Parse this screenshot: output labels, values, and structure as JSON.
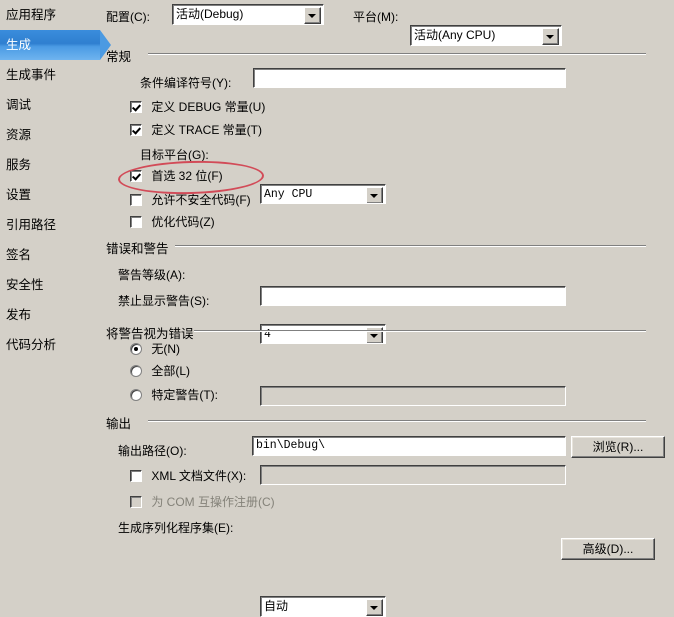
{
  "sidebar": {
    "items": [
      {
        "label": "应用程序",
        "selected": false
      },
      {
        "label": "生成",
        "selected": true
      },
      {
        "label": "生成事件",
        "selected": false
      },
      {
        "label": "调试",
        "selected": false
      },
      {
        "label": "资源",
        "selected": false
      },
      {
        "label": "服务",
        "selected": false
      },
      {
        "label": "设置",
        "selected": false
      },
      {
        "label": "引用路径",
        "selected": false
      },
      {
        "label": "签名",
        "selected": false
      },
      {
        "label": "安全性",
        "selected": false
      },
      {
        "label": "发布",
        "selected": false
      },
      {
        "label": "代码分析",
        "selected": false
      }
    ]
  },
  "top": {
    "configuration_label": "配置(C):",
    "configuration_value": "活动(Debug)",
    "platform_label": "平台(M):",
    "platform_value": "活动(Any CPU)"
  },
  "general": {
    "title": "常规",
    "conditional_symbols_label": "条件编译符号(Y):",
    "conditional_symbols_value": "",
    "define_debug_label": "定义 DEBUG 常量(U)",
    "define_debug_checked": true,
    "define_trace_label": "定义 TRACE 常量(T)",
    "define_trace_checked": true,
    "target_platform_label": "目标平台(G):",
    "target_platform_value": "Any CPU",
    "prefer32_label": "首选 32 位(F)",
    "prefer32_checked": true,
    "unsafe_label": "允许不安全代码(F)",
    "unsafe_checked": false,
    "optimize_label": "优化代码(Z)",
    "optimize_checked": false
  },
  "errors": {
    "title": "错误和警告",
    "warning_level_label": "警告等级(A):",
    "warning_level_value": "4",
    "suppress_warnings_label": "禁止显示警告(S):",
    "suppress_warnings_value": ""
  },
  "treat_warnings": {
    "title": "将警告视为错误",
    "none_label": "无(N)",
    "none_selected": true,
    "all_label": "全部(L)",
    "all_selected": false,
    "specific_label": "特定警告(T):",
    "specific_selected": false,
    "specific_value": ""
  },
  "output": {
    "title": "输出",
    "path_label": "输出路径(O):",
    "path_value": "bin\\Debug\\",
    "browse_label": "浏览(R)...",
    "xml_doc_label": "XML 文档文件(X):",
    "xml_doc_checked": false,
    "xml_doc_value": "",
    "com_interop_label": "为 COM 互操作注册(C)",
    "com_interop_checked": false,
    "serialization_label": "生成序列化程序集(E):",
    "serialization_value": "自动",
    "advanced_label": "高级(D)..."
  },
  "annotation": {
    "shape": "ellipse",
    "color": "#d24b58",
    "target": "首选 32 位(F)"
  }
}
